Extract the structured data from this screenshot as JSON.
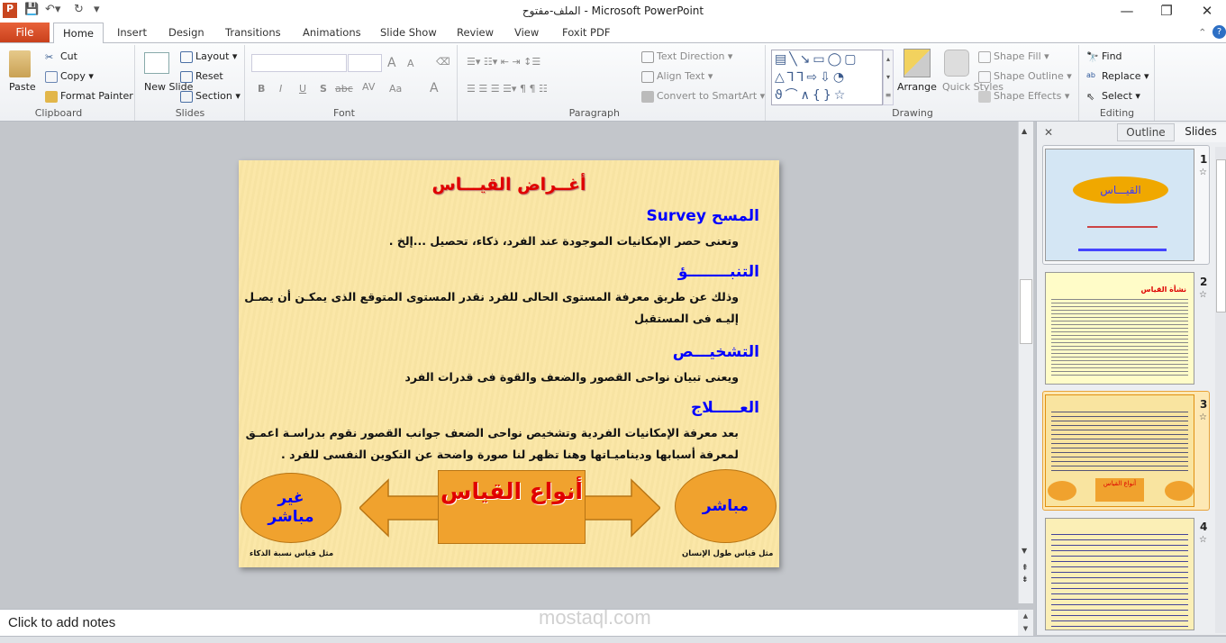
{
  "window": {
    "title": "الملف-مفتوح - Microsoft PowerPoint",
    "app_icon": "P"
  },
  "tabs": [
    "File",
    "Home",
    "Insert",
    "Design",
    "Transitions",
    "Animations",
    "Slide Show",
    "Review",
    "View",
    "Foxit PDF"
  ],
  "ribbon": {
    "clipboard": {
      "label": "Clipboard",
      "paste": "Paste",
      "cut": "Cut",
      "copy": "Copy",
      "format_painter": "Format Painter"
    },
    "slides": {
      "label": "Slides",
      "new_slide": "New Slide",
      "layout": "Layout",
      "reset": "Reset",
      "section": "Section"
    },
    "font": {
      "label": "Font",
      "font_name": "",
      "font_size": "",
      "bold": "B",
      "italic": "I",
      "underline": "U",
      "shadow": "S",
      "strike": "abc",
      "spacing": "AV",
      "case": "Aa",
      "color": "A",
      "grow": "A",
      "shrink": "A"
    },
    "paragraph": {
      "label": "Paragraph",
      "text_direction": "Text Direction",
      "align_text": "Align Text",
      "smartart": "Convert to SmartArt"
    },
    "drawing": {
      "label": "Drawing",
      "arrange": "Arrange",
      "quick_styles": "Quick Styles",
      "shape_fill": "Shape Fill",
      "shape_outline": "Shape Outline",
      "shape_effects": "Shape Effects"
    },
    "editing": {
      "label": "Editing",
      "find": "Find",
      "replace": "Replace",
      "select": "Select"
    }
  },
  "slide": {
    "title": "أغــراض القيـــاس",
    "sections": [
      {
        "heading": "المسح Survey",
        "body": "وتعنى حصر الإمكانيات الموجودة عند الفرد، ذكاء، تحصيل ...إلخ ."
      },
      {
        "heading": "التنبــــــــؤ",
        "body": "وذلك عن طريق معرفة المستوى الحالى للفرد نقدر المستوى المتوقع الذى يمكـن أن يصـل إليـه فى المستقبل"
      },
      {
        "heading": "التشخيـــص",
        "body": "ويعنى تبيان نواحى القصور والضعف والقوة فى قدرات الفرد"
      },
      {
        "heading": "العـــــلاج",
        "body": "بعد معرفة الإمكانيات الفردية وتشخيص نواحى الضعف جوانب القصور نقوم بدراسـة اعمـق لمعرفة أسبابها وديناميـاتها وهنا تظهر لنا صورة واضحة عن التكوين النفسى للفرد ."
      }
    ],
    "center_box": "أنواع القياس",
    "left_oval": "غير مباشر",
    "right_oval": "مباشر",
    "left_caption": "مثل قياس نسبة الذكاء",
    "right_caption": "مثل قياس طول الإنسان"
  },
  "panel": {
    "tab_outline": "Outline",
    "tab_slides": "Slides",
    "slide_numbers": [
      "1",
      "2",
      "3",
      "4"
    ],
    "selected": 3,
    "thumb1_title": "القيـــاس",
    "thumb2_title": "نشأة القياس",
    "thumb3_box": "أنواع القياس"
  },
  "notes": {
    "placeholder": "Click to add notes"
  },
  "watermark": "mostaql.com"
}
